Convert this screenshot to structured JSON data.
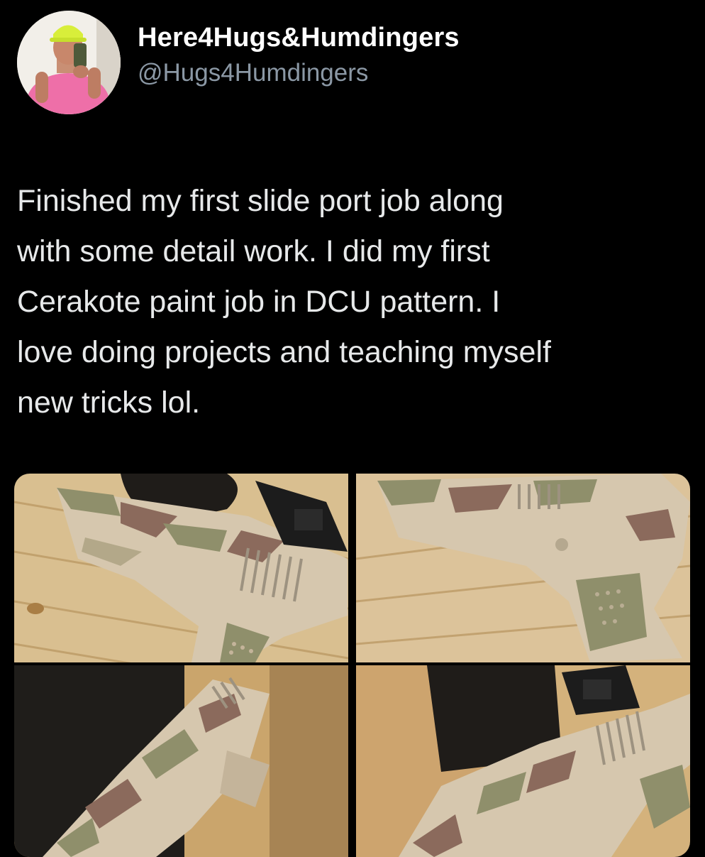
{
  "author": {
    "display_name": "Here4Hugs&Humdingers",
    "handle": "@Hugs4Humdingers",
    "avatar_icon": "profile-photo-avatar"
  },
  "tweet": {
    "text": "Finished my first slide port job along\nwith some detail work. I did my first\nCerakote paint job in DCU pattern. I\nlove doing projects and teaching myself\nnew tricks lol."
  },
  "media": {
    "count": 4,
    "items": [
      {
        "name": "photo-1",
        "description_icon": "camo-pistol-photo"
      },
      {
        "name": "photo-2",
        "description_icon": "camo-pistol-photo"
      },
      {
        "name": "photo-3",
        "description_icon": "camo-pistol-photo"
      },
      {
        "name": "photo-4",
        "description_icon": "camo-pistol-photo"
      }
    ],
    "colors": {
      "wood_light": "#d9bf90",
      "wood_dark": "#b8955f",
      "camo_tan": "#d6c7ae",
      "camo_green": "#8f8f6b",
      "camo_brown": "#8b6a5c",
      "optic_black": "#1c1c1c"
    }
  },
  "theme": {
    "background": "#000000",
    "text_primary": "#e7e9ea",
    "text_secondary": "#8b98a5"
  }
}
